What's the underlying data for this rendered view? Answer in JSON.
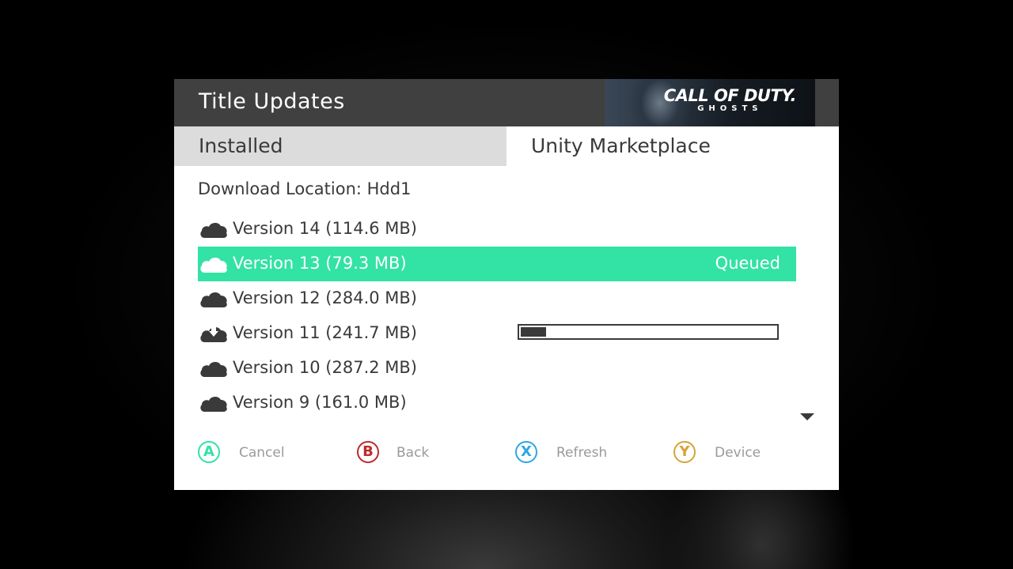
{
  "header": {
    "title": "Title Updates",
    "banner_line1": "CALL OF DUTY.",
    "banner_line2": "GHOSTS"
  },
  "tabs": [
    {
      "label": "Installed",
      "selected": true
    },
    {
      "label": "Unity Marketplace",
      "selected": false
    }
  ],
  "download_location": "Download Location: Hdd1",
  "versions": [
    {
      "label": "Version 14 (114.6 MB)",
      "icon": "cloud-icon",
      "status": ""
    },
    {
      "label": "Version 13 (79.3 MB)",
      "icon": "cloud-icon",
      "status": "Queued",
      "highlighted": true
    },
    {
      "label": "Version 12 (284.0 MB)",
      "icon": "cloud-icon",
      "status": ""
    },
    {
      "label": "Version 11 (241.7 MB)",
      "icon": "cloud-download-icon",
      "status": "",
      "progress": 0.1
    },
    {
      "label": "Version 10 (287.2 MB)",
      "icon": "cloud-icon",
      "status": ""
    },
    {
      "label": "Version 9 (161.0 MB)",
      "icon": "cloud-icon",
      "status": ""
    }
  ],
  "buttons": [
    {
      "key": "A",
      "label": "Cancel",
      "color": "#33e2a5"
    },
    {
      "key": "B",
      "label": "Back",
      "color": "#c0292b"
    },
    {
      "key": "X",
      "label": "Refresh",
      "color": "#2ea6e6"
    },
    {
      "key": "Y",
      "label": "Device",
      "color": "#d6a436"
    }
  ],
  "colors": {
    "highlight": "#33e2a5",
    "header": "#404040",
    "tab_selected": "#dcdcdc"
  }
}
